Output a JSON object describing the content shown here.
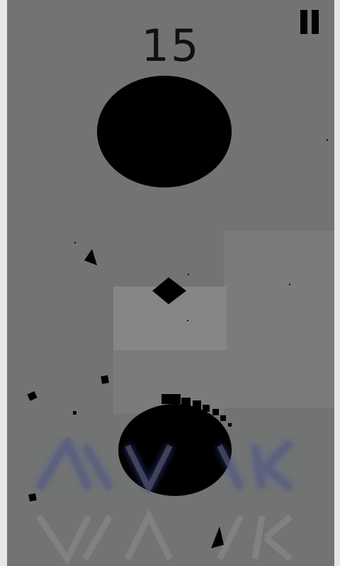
{
  "game": {
    "score": "15",
    "pause_icon": "pause-icon",
    "colors": {
      "background": "#727473",
      "panel": "#7a7c7b",
      "shapes": "#000000",
      "logo_glow": "#3c4ca8"
    }
  }
}
